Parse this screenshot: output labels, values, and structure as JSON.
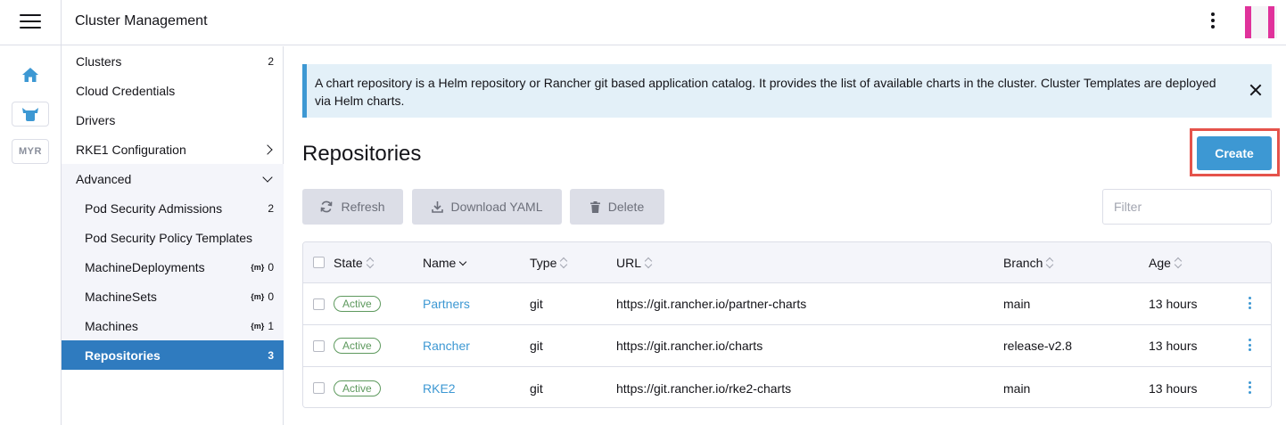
{
  "header": {
    "title": "Cluster Management"
  },
  "rail": {
    "myr_label": "MYR"
  },
  "sidenav": {
    "clusters": {
      "label": "Clusters",
      "count": "2"
    },
    "cloud_credentials": {
      "label": "Cloud Credentials"
    },
    "drivers": {
      "label": "Drivers"
    },
    "rke1": {
      "label": "RKE1 Configuration"
    },
    "advanced": {
      "label": "Advanced"
    },
    "pod_security_admissions": {
      "label": "Pod Security Admissions",
      "count": "2"
    },
    "psp_templates": {
      "label": "Pod Security Policy Templates"
    },
    "machine_deployments": {
      "label": "MachineDeployments",
      "icon": "{m}",
      "count": "0"
    },
    "machine_sets": {
      "label": "MachineSets",
      "icon": "{m}",
      "count": "0"
    },
    "machines": {
      "label": "Machines",
      "icon": "{m}",
      "count": "1"
    },
    "repositories": {
      "label": "Repositories",
      "count": "3"
    }
  },
  "banner": {
    "text": "A chart repository is a Helm repository or Rancher git based application catalog. It provides the list of available charts in the cluster. Cluster Templates are deployed via Helm charts."
  },
  "page": {
    "title": "Repositories",
    "create_label": "Create"
  },
  "toolbar": {
    "refresh_label": "Refresh",
    "download_label": "Download YAML",
    "delete_label": "Delete",
    "filter_placeholder": "Filter"
  },
  "table": {
    "headers": {
      "state": "State",
      "name": "Name",
      "type": "Type",
      "url": "URL",
      "branch": "Branch",
      "age": "Age"
    },
    "rows": [
      {
        "state": "Active",
        "name": "Partners",
        "type": "git",
        "url": "https://git.rancher.io/partner-charts",
        "branch": "main",
        "age": "13 hours"
      },
      {
        "state": "Active",
        "name": "Rancher",
        "type": "git",
        "url": "https://git.rancher.io/charts",
        "branch": "release-v2.8",
        "age": "13 hours"
      },
      {
        "state": "Active",
        "name": "RKE2",
        "type": "git",
        "url": "https://git.rancher.io/rke2-charts",
        "branch": "main",
        "age": "13 hours"
      }
    ]
  },
  "colors": {
    "accent": "#3d98d3",
    "active_nav": "#2f7bbf",
    "status_active": "#5d995d",
    "highlight_border": "#e5534b",
    "banner_bg": "#e3f0f8"
  },
  "icons": {
    "menu": "hamburger-icon",
    "home": "home-icon",
    "cluster_mgmt": "cow-icon",
    "refresh": "refresh-icon",
    "download": "download-icon",
    "delete": "trash-icon"
  }
}
